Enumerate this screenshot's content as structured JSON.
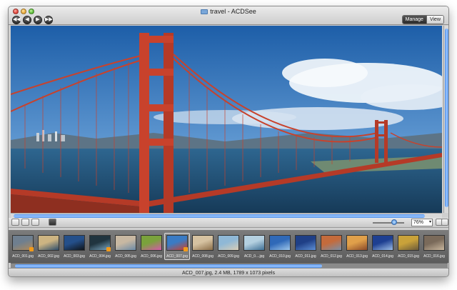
{
  "window": {
    "title": "travel - ACDSee",
    "mode_buttons": {
      "manage": "Manage",
      "view": "View"
    }
  },
  "nav": [
    {
      "name": "back",
      "glyph": "◀◀"
    },
    {
      "name": "previous",
      "glyph": "◀"
    },
    {
      "name": "next",
      "glyph": "▶"
    },
    {
      "name": "forward",
      "glyph": "▶▶"
    }
  ],
  "viewer": {
    "image_subject": "Golden Gate Bridge photo",
    "zoom": {
      "value": "76%",
      "level": 0.6
    }
  },
  "filmstrip": {
    "selected_index": 6,
    "items": [
      {
        "label": "ACD_001.jpg",
        "colors": [
          "#6f7f8f",
          "#b08a5b"
        ],
        "badge": true
      },
      {
        "label": "ACD_002.jpg",
        "colors": [
          "#cdb482",
          "#2e4d6b"
        ],
        "badge": false
      },
      {
        "label": "ACD_003.jpg",
        "colors": [
          "#244f8a",
          "#101418"
        ],
        "badge": false
      },
      {
        "label": "ACD_004.jpg",
        "colors": [
          "#20343f",
          "#7ba7c1"
        ],
        "badge": true
      },
      {
        "label": "ACD_005.jpg",
        "colors": [
          "#c8b8a2",
          "#6b8aa6"
        ],
        "badge": false
      },
      {
        "label": "ACD_006.jpg",
        "colors": [
          "#7aa23c",
          "#d45aa8"
        ],
        "badge": false
      },
      {
        "label": "ACD_007.jpg",
        "colors": [
          "#3a7bc4",
          "#c9412e"
        ],
        "badge": true
      },
      {
        "label": "ACD_008.jpg",
        "colors": [
          "#d6c2a1",
          "#8a6d48"
        ],
        "badge": false
      },
      {
        "label": "ACD_009.jpg",
        "colors": [
          "#8fb8d6",
          "#d8cdb6"
        ],
        "badge": false
      },
      {
        "label": "ACD_0....jpg",
        "colors": [
          "#b4d0e0",
          "#3e6f95"
        ],
        "badge": false
      },
      {
        "label": "ACD_010.jpg",
        "colors": [
          "#2f69b8",
          "#9dc6ea"
        ],
        "badge": false
      },
      {
        "label": "ACD_011.jpg",
        "colors": [
          "#1f3f86",
          "#5e8fd4"
        ],
        "badge": false
      },
      {
        "label": "ACD_012.jpg",
        "colors": [
          "#c46b3c",
          "#7a8fa6"
        ],
        "badge": false
      },
      {
        "label": "ACD_013.jpg",
        "colors": [
          "#e0a04a",
          "#8a4a2a"
        ],
        "badge": false
      },
      {
        "label": "ACD_014.jpg",
        "colors": [
          "#1e3f91",
          "#9bbce6"
        ],
        "badge": false
      },
      {
        "label": "ACD_015.jpg",
        "colors": [
          "#c9a23a",
          "#6b5a3a"
        ],
        "badge": false
      },
      {
        "label": "ACD_016.jpg",
        "colors": [
          "#7a6a5a",
          "#c9b79e"
        ],
        "badge": false
      }
    ]
  },
  "status": {
    "text": "ACD_007.jpg, 2.4 MB, 1789 x 1073 pixels"
  },
  "colors": {
    "accent": "#3f84d8",
    "bridge": "#c8422c",
    "sky": "#2f6fba",
    "water": "#1f4f78"
  }
}
